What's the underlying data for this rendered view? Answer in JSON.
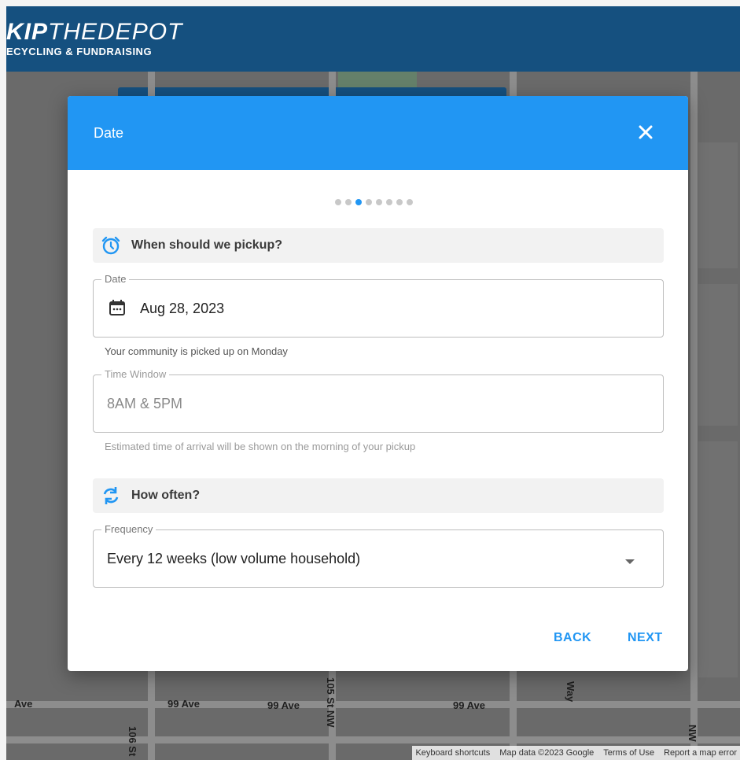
{
  "header": {
    "logo_bold": "KIP",
    "logo_light": "THEDEPOT",
    "logo_tagline": "ECYCLING & FUNDRAISING"
  },
  "map": {
    "streets": [
      "Ave",
      "99 Ave",
      "99 Ave",
      "99 Ave",
      "106 St",
      "105 St NW",
      "Way",
      "NW"
    ],
    "attribution": [
      "Keyboard shortcuts",
      "Map data ©2023 Google",
      "Terms of Use",
      "Report a map error"
    ]
  },
  "modal": {
    "title": "Date",
    "step_total": 8,
    "step_current": 3,
    "pickup_section": {
      "label": "When should we pickup?",
      "icon": "alarm-clock-icon"
    },
    "date_field": {
      "legend": "Date",
      "value": "Aug 28, 2023",
      "icon": "calendar-icon"
    },
    "date_helper": "Your community is picked up on Monday",
    "time_field": {
      "legend": "Time Window",
      "value": "8AM & 5PM"
    },
    "time_helper": "Estimated time of arrival will be shown on the morning of your pickup",
    "frequency_section": {
      "label": "How often?",
      "icon": "refresh-icon"
    },
    "frequency_field": {
      "legend": "Frequency",
      "value": "Every 12 weeks (low volume household)",
      "icon": "dropdown-arrow-icon"
    },
    "back_label": "BACK",
    "next_label": "NEXT"
  },
  "colors": {
    "header_bg": "#15507f",
    "modal_header_bg": "#2196f3",
    "accent": "#2196f3"
  }
}
